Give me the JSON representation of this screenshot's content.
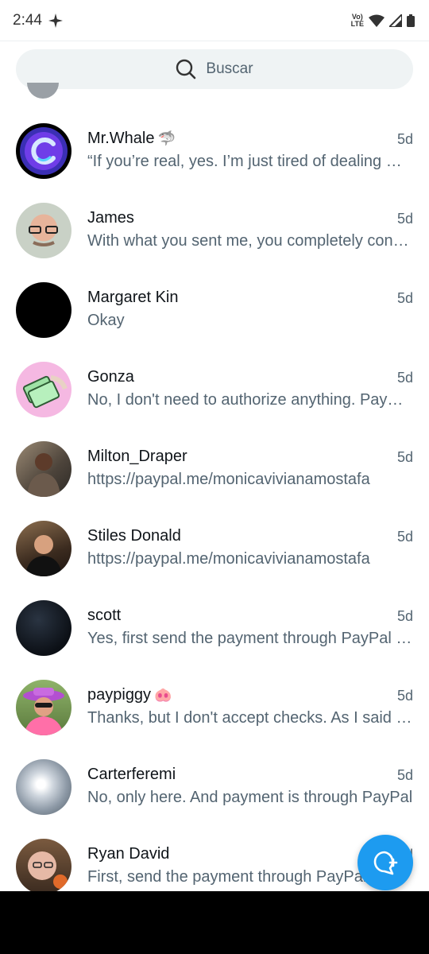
{
  "status_bar": {
    "time": "2:44",
    "network_label": "LTE",
    "network_top": "Vo)",
    "icons": [
      "sparkle-icon",
      "volte-icon",
      "wifi-icon",
      "signal-icon",
      "battery-icon"
    ]
  },
  "search": {
    "placeholder": "Buscar",
    "icon": "search-icon"
  },
  "conversations": [
    {
      "name": "Mr.Whale",
      "emoji": "🦈",
      "time": "5d",
      "preview": "“If you’re real, yes. I’m just tired of dealing with scammers",
      "avatar": "whale-logo"
    },
    {
      "name": "James",
      "emoji": "",
      "time": "5d",
      "preview": "With what you sent me, you completely confirmed it",
      "avatar": "james-photo"
    },
    {
      "name": "Margaret Kin",
      "emoji": "",
      "time": "5d",
      "preview": "Okay",
      "avatar": "black-avatar"
    },
    {
      "name": "Gonza",
      "emoji": "",
      "time": "5d",
      "preview": "No, I don't need to authorize anything. PayPal does it",
      "avatar": "money-illustration"
    },
    {
      "name": "Milton_Draper",
      "emoji": "",
      "time": "5d",
      "preview": "https://paypal.me/monicavivianamostafa",
      "avatar": "milton-photo"
    },
    {
      "name": "Stiles Donald",
      "emoji": "",
      "time": "5d",
      "preview": "https://paypal.me/monicavivianamostafa",
      "avatar": "stiles-photo"
    },
    {
      "name": "scott",
      "emoji": "",
      "time": "5d",
      "preview": "Yes, first send the payment through PayPal and then",
      "avatar": "dark-texture"
    },
    {
      "name": "paypiggy",
      "emoji": "🐽",
      "time": "5d",
      "preview": "Thanks, but I don't accept checks. As I said before",
      "avatar": "cowboy-photo"
    },
    {
      "name": "Carterferemi",
      "emoji": "",
      "time": "5d",
      "preview": "No, only here. And payment is through PayPal",
      "avatar": "sky-photo"
    },
    {
      "name": "Ryan David",
      "emoji": "",
      "time": "5d",
      "preview": "First, send the payment through PayPal",
      "avatar": "ryan-photo"
    }
  ],
  "fab": {
    "icon": "new-message-icon",
    "color": "#1d9bf0"
  },
  "colors": {
    "primary_text": "#0f1419",
    "secondary_text": "#536471",
    "accent": "#1d9bf0",
    "search_bg": "#eff3f4"
  }
}
